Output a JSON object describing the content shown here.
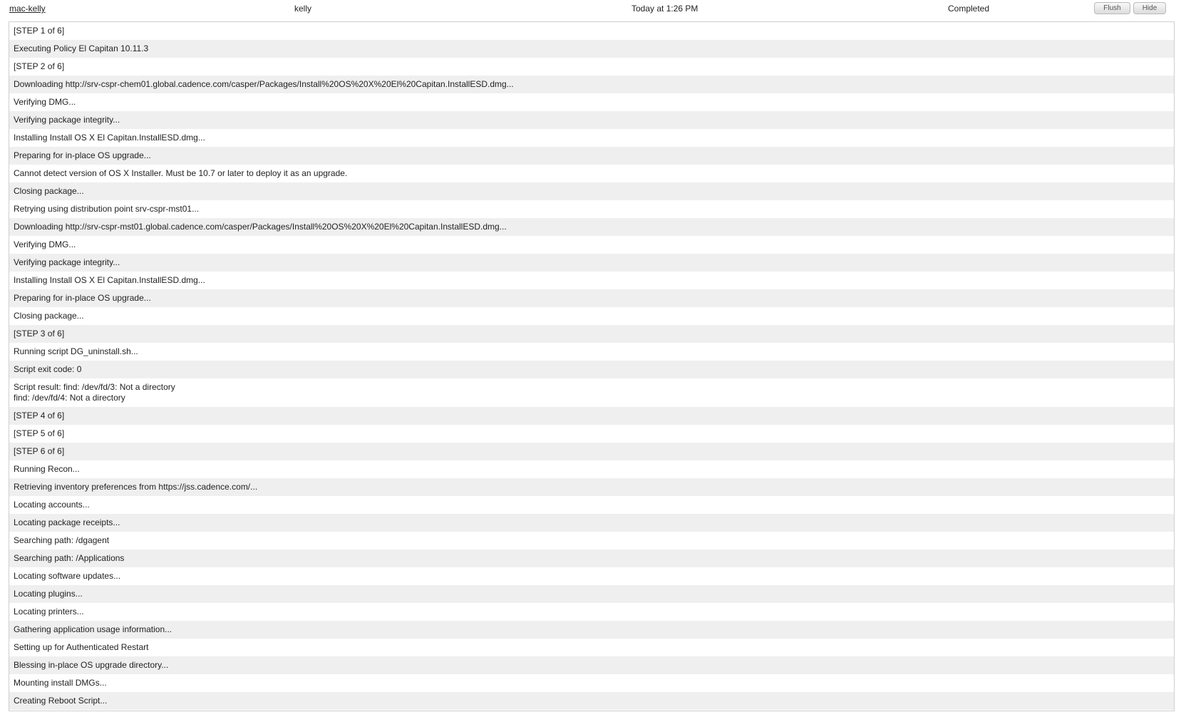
{
  "header": {
    "computer": "mac-kelly",
    "user": "kelly",
    "time": "Today at 1:26 PM",
    "status": "Completed",
    "flush_label": "Flush",
    "hide_label": "Hide"
  },
  "log_lines": [
    "[STEP 1 of 6]",
    "Executing Policy El Capitan 10.11.3",
    "[STEP 2 of 6]",
    "Downloading http://srv-cspr-chem01.global.cadence.com/casper/Packages/Install%20OS%20X%20El%20Capitan.InstallESD.dmg...",
    "Verifying DMG...",
    "Verifying package integrity...",
    "Installing Install OS X El Capitan.InstallESD.dmg...",
    "Preparing for in-place OS upgrade...",
    "Cannot detect version of OS X Installer. Must be 10.7 or later to deploy it as an upgrade.",
    "Closing package...",
    "Retrying using distribution point srv-cspr-mst01...",
    "Downloading http://srv-cspr-mst01.global.cadence.com/casper/Packages/Install%20OS%20X%20El%20Capitan.InstallESD.dmg...",
    "Verifying DMG...",
    "Verifying package integrity...",
    "Installing Install OS X El Capitan.InstallESD.dmg...",
    "Preparing for in-place OS upgrade...",
    "Closing package...",
    "[STEP 3 of 6]",
    "Running script DG_uninstall.sh...",
    "Script exit code: 0",
    "Script result: find: /dev/fd/3: Not a directory\nfind: /dev/fd/4: Not a directory",
    "[STEP 4 of 6]",
    "[STEP 5 of 6]",
    "[STEP 6 of 6]",
    "Running Recon...",
    "Retrieving inventory preferences from https://jss.cadence.com/...",
    "Locating accounts...",
    "Locating package receipts...",
    "Searching path: /dgagent",
    "Searching path: /Applications",
    "Locating software updates...",
    "Locating plugins...",
    "Locating printers...",
    "Gathering application usage information...",
    "Setting up for Authenticated Restart",
    "Blessing in-place OS upgrade directory...",
    "Mounting install DMGs...",
    "Creating Reboot Script..."
  ]
}
